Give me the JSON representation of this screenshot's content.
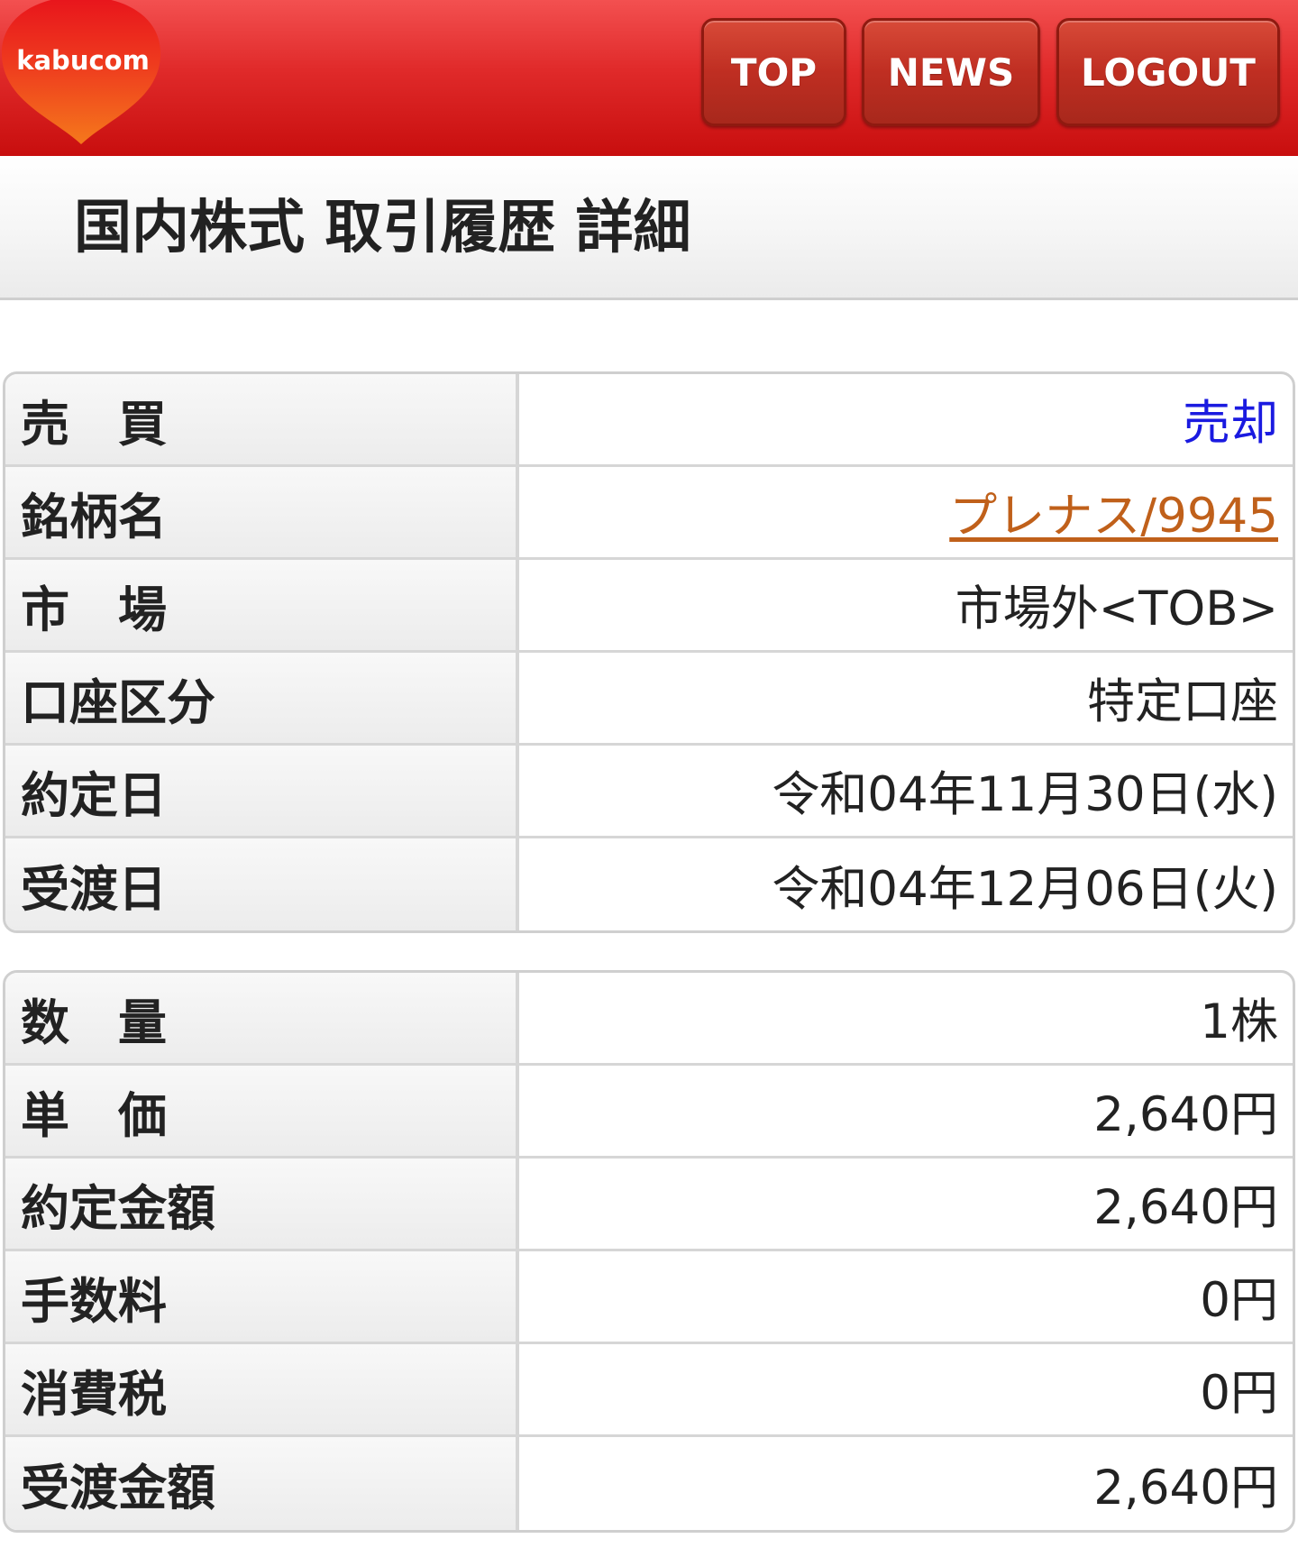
{
  "header": {
    "logo_text": "kabucom",
    "nav": {
      "top": "TOP",
      "news": "NEWS",
      "logout": "LOGOUT"
    }
  },
  "page_title": "国内株式 取引履歴 詳細",
  "trade_info": [
    {
      "label": "売　買",
      "value": "売却"
    },
    {
      "label": "銘柄名",
      "value": "プレナス/9945"
    },
    {
      "label": "市　場",
      "value": "市場外<TOB>"
    },
    {
      "label": "口座区分",
      "value": "特定口座"
    },
    {
      "label": "約定日",
      "value": "令和04年11月30日(水)"
    },
    {
      "label": "受渡日",
      "value": "令和04年12月06日(火)"
    }
  ],
  "amount_info": [
    {
      "label": "数　量",
      "value": "1株"
    },
    {
      "label": "単　価",
      "value": "2,640円"
    },
    {
      "label": "約定金額",
      "value": "2,640円"
    },
    {
      "label": "手数料",
      "value": "0円"
    },
    {
      "label": "消費税",
      "value": "0円"
    },
    {
      "label": "受渡金額",
      "value": "2,640円"
    }
  ],
  "colors": {
    "header_red": "#d01818",
    "logo_orange": "#f2641e",
    "sell_blue": "#1a1ae0",
    "link_orange": "#c0601a"
  }
}
